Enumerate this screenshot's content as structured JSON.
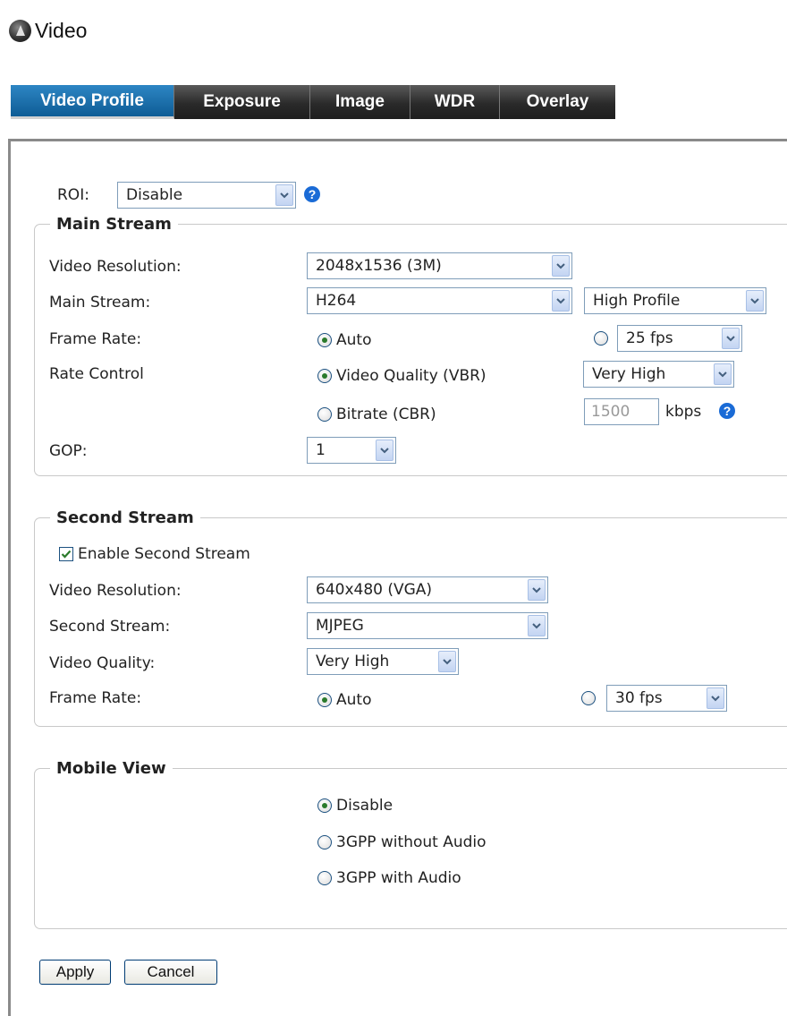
{
  "header": {
    "title": "Video"
  },
  "tabs": [
    {
      "label": "Video Profile",
      "active": true
    },
    {
      "label": "Exposure"
    },
    {
      "label": "Image"
    },
    {
      "label": "WDR"
    },
    {
      "label": "Overlay"
    }
  ],
  "roi": {
    "label": "ROI:",
    "value": "Disable"
  },
  "main_stream": {
    "legend": "Main Stream",
    "resolution_label": "Video Resolution:",
    "resolution_value": "2048x1536 (3M)",
    "codec_label": "Main Stream:",
    "codec_value": "H264",
    "profile_value": "High Profile",
    "frame_rate_label": "Frame Rate:",
    "frame_rate_auto": "Auto",
    "frame_rate_value": "25 fps",
    "rate_control_label": "Rate Control",
    "vbr_label": "Video Quality (VBR)",
    "vbr_value": "Very High",
    "cbr_label": "Bitrate (CBR)",
    "cbr_value": "1500",
    "cbr_unit": "kbps",
    "gop_label": "GOP:",
    "gop_value": "1"
  },
  "second_stream": {
    "legend": "Second Stream",
    "enable_label": "Enable Second Stream",
    "resolution_label": "Video Resolution:",
    "resolution_value": "640x480 (VGA)",
    "codec_label": "Second Stream:",
    "codec_value": "MJPEG",
    "quality_label": "Video Quality:",
    "quality_value": "Very High",
    "frame_rate_label": "Frame Rate:",
    "frame_rate_auto": "Auto",
    "frame_rate_value": "30 fps"
  },
  "mobile_view": {
    "legend": "Mobile View",
    "options": [
      "Disable",
      "3GPP without Audio",
      "3GPP with Audio"
    ]
  },
  "buttons": {
    "apply": "Apply",
    "cancel": "Cancel"
  },
  "colors": {
    "tab_active": "#1a6fae",
    "tab_bar": "#2a2a2a",
    "help_icon": "#1a6bd6",
    "radio_dot": "#2b7a2b",
    "check_mark": "#2b7a2b"
  },
  "icons": {
    "dropdown": "chevron-down-icon",
    "help": "question-icon",
    "logo": "camera-logo-icon"
  }
}
